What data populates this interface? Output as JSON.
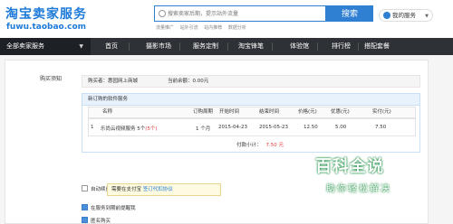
{
  "header": {
    "logo": "淘宝卖家服务",
    "logo_url": "fuwu.taobao.com",
    "search_placeholder": "搜索卖家后期，提示站外流量",
    "search_button": "搜索",
    "quick_links": [
      "流量推广",
      "站外引流",
      "站内推荐",
      "数据分析"
    ],
    "user_menu": "我的服务"
  },
  "nav": {
    "all_services": "全部卖家服务",
    "items": [
      "首页",
      "摄影市场",
      "服务定制",
      "淘宝锋笔",
      "体验馆",
      "排行榜",
      "搭配套餐"
    ]
  },
  "form": {
    "buy_label": "购买须知",
    "buyer": "购买者：惠园网上商城",
    "balance": "当前余额：0.00元",
    "order_title": "新订购的软件服务",
    "columns": [
      "名称",
      "订购周期",
      "开始时间",
      "结束时间",
      "价格(元)",
      "优惠(元)",
      "实付(元)"
    ],
    "rows": [
      {
        "index": "1",
        "name": "乐尚云视频服务",
        "tier": "5个",
        "tier_extra": "(5个)",
        "period": "1 个月",
        "start": "2015-04-23",
        "end": "2015-05-23",
        "price": "12.50",
        "discount": "5.00",
        "paid": "7.50"
      }
    ],
    "total_label": "付款小计：",
    "total_amount": "7.50 元",
    "auto_renew": "自动续费",
    "tip_text": "需要在支付宝",
    "tip_link": "签订代扣协议",
    "notify_label": "在服务到期前提醒我",
    "anon_label": "匿名购买"
  },
  "watermark": {
    "big": "百科全说",
    "small": "助你轻松解决"
  },
  "colors": {
    "brand": "#1d7ad9",
    "nav_bg": "#2e3135",
    "accent_red": "#e4393c"
  }
}
